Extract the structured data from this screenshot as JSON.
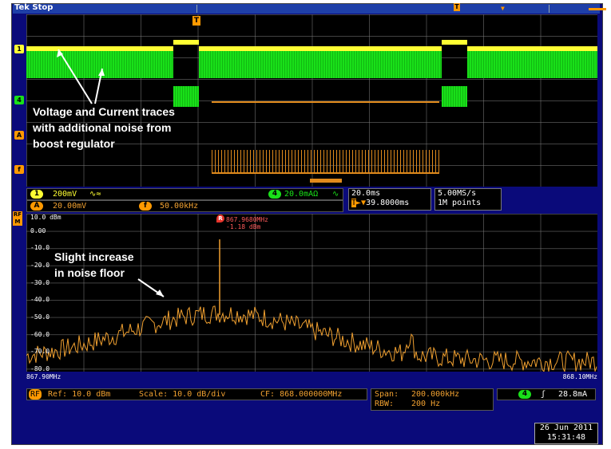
{
  "header": {
    "brand": "Tek",
    "run_state": "Stop"
  },
  "trigger": {
    "position_label": "T"
  },
  "channels": {
    "ch1": "1",
    "ch4": "4",
    "math": "A",
    "f": "f"
  },
  "annotations": {
    "traces_note": [
      "Voltage and Current traces",
      "with additional noise from",
      "boost regulator"
    ],
    "noise_note": [
      "Slight increase",
      "in noise floor"
    ]
  },
  "status": {
    "ch1_scale": "200mV",
    "ch1_extra": "∿≈",
    "ch4_scale": "20.0mAΩ",
    "ch4_extra": "∿",
    "math_scale": "20.00mV",
    "f_freq": "50.00kHz",
    "timebase": "20.0ms",
    "trigger_pos": "39.8000ms",
    "sample_rate": "5.00MS/s",
    "record_length": "1M points"
  },
  "spectrum": {
    "marker_freq": "867.9680MHz",
    "marker_level": "-1.18 dBm",
    "marker_symbol": "R",
    "dbm_ticks": [
      "10.0 dBm",
      "0.00",
      "-10.0",
      "-20.0",
      "-30.0",
      "-40.0",
      "-50.0",
      "-60.0",
      "-70.0",
      "-80.0"
    ],
    "start_freq": "867.90MHz",
    "stop_freq": "868.10MHz"
  },
  "rf_settings": {
    "badge": "RF",
    "ref": "Ref: 10.0 dBm",
    "scale": "Scale: 10.0 dB/div",
    "cf": "CF: 868.000000MHz",
    "span_label": "Span:",
    "span": "200.000kHz",
    "rbw_label": "RBW:",
    "rbw": "200 Hz"
  },
  "trigger_readout": {
    "channel": "4",
    "slope": "ʃ",
    "level": "28.8mA"
  },
  "datetime": {
    "date": "26 Jun 2011",
    "time": "15:31:48"
  },
  "colors": {
    "ch1": "#ffff33",
    "ch4": "#19e019",
    "math": "#e08a1c",
    "rf": "#f0a030",
    "frame": "#0a0a7a"
  }
}
